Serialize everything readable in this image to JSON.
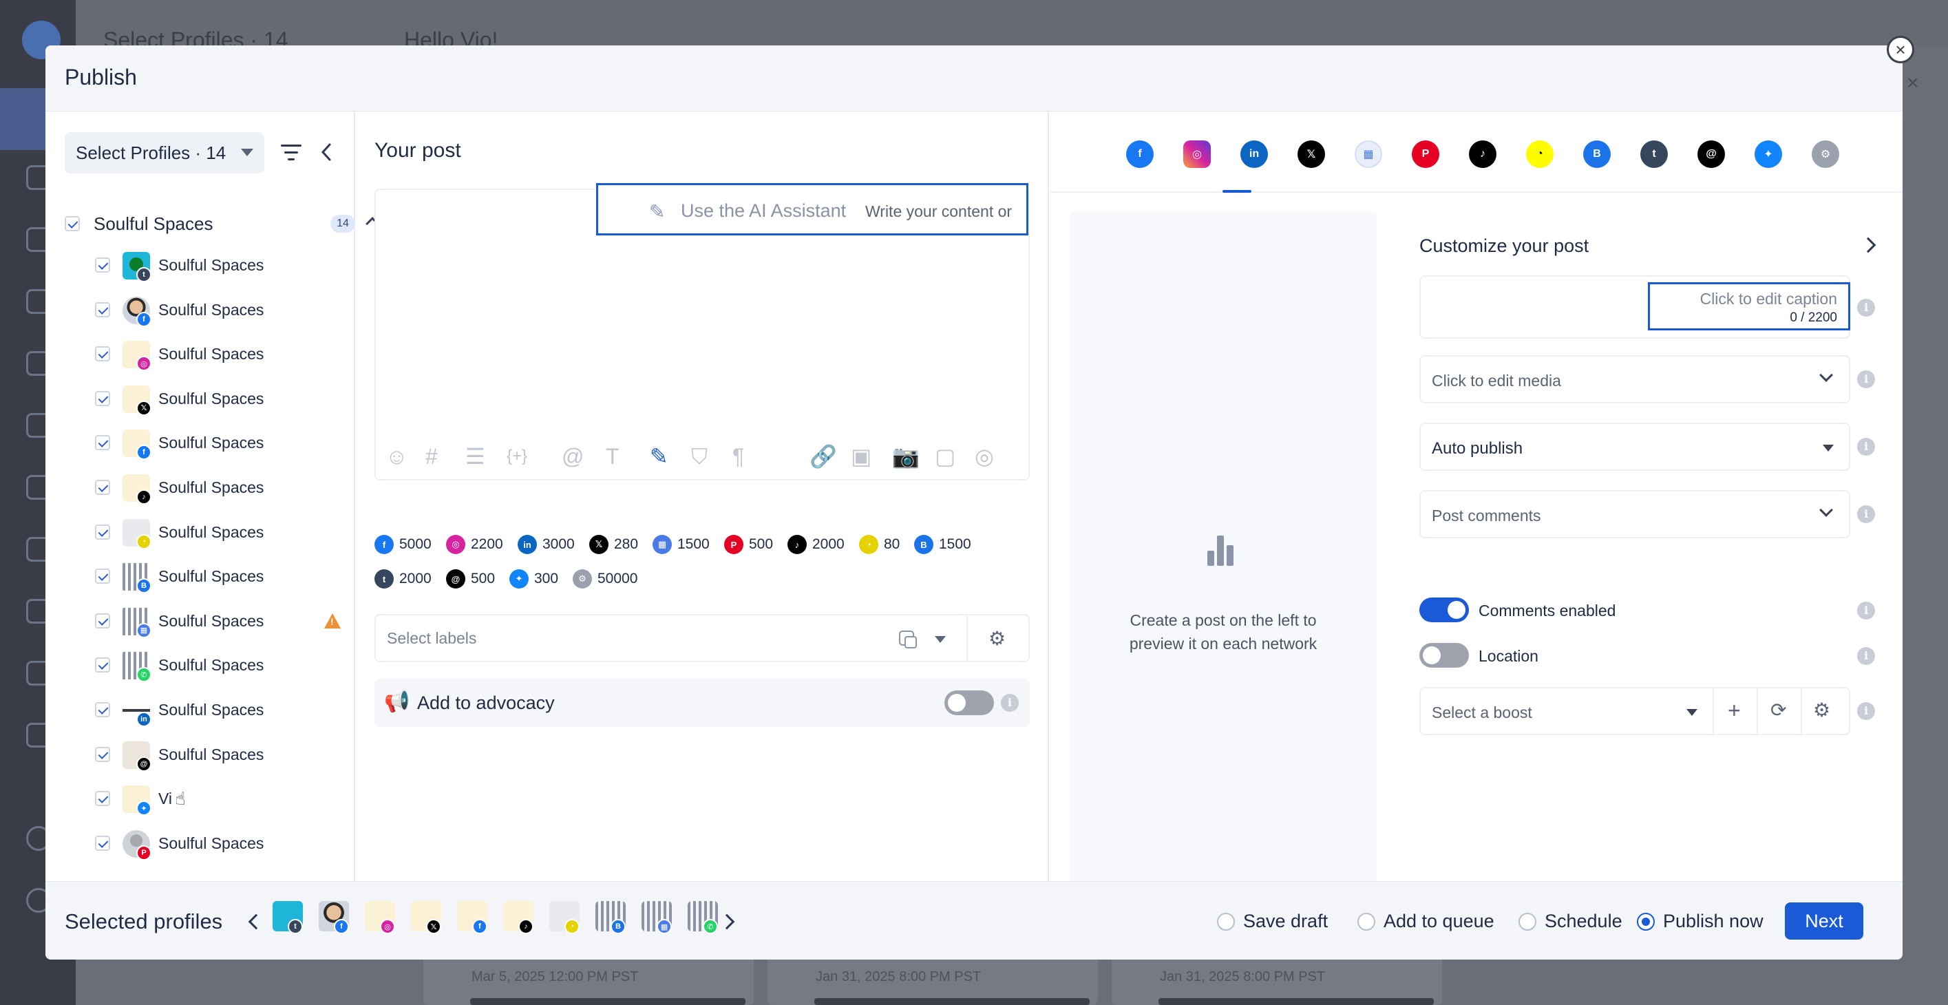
{
  "background": {
    "header_title": "Hello Vio!",
    "header_select": "Select Profiles · 14",
    "card_dates": [
      "Mar 5, 2025 12:00 PM PST",
      "Jan 31, 2025 8:00 PM PST",
      "Jan 31, 2025 8:00 PM PST"
    ]
  },
  "modal": {
    "title": "Publish",
    "close_label": "×"
  },
  "profiles": {
    "select_label": "Select Profiles · 14",
    "group_name": "Soulful Spaces",
    "group_count": "14",
    "items": [
      {
        "name": "Soulful Spaces",
        "avatar": "tumblr",
        "network": "tumblr",
        "net_glyph": "t",
        "net_color": "#36465d"
      },
      {
        "name": "Soulful Spaces",
        "avatar": "photo",
        "network": "facebook",
        "net_glyph": "f",
        "net_color": "#1877f2"
      },
      {
        "name": "Soulful Spaces",
        "avatar": "logo",
        "network": "instagram",
        "net_glyph": "◎",
        "net_color": "#d6249f"
      },
      {
        "name": "Soulful Spaces",
        "avatar": "logo",
        "network": "x",
        "net_glyph": "𝕏",
        "net_color": "#000000"
      },
      {
        "name": "Soulful Spaces",
        "avatar": "logo",
        "network": "facebook",
        "net_glyph": "f",
        "net_color": "#1877f2"
      },
      {
        "name": "Soulful Spaces",
        "avatar": "logo",
        "network": "tiktok",
        "net_glyph": "♪",
        "net_color": "#000000"
      },
      {
        "name": "Soulful Spaces",
        "avatar": "snap",
        "network": "snapchat",
        "net_glyph": "◔",
        "net_color": "#e6d200"
      },
      {
        "name": "Soulful Spaces",
        "avatar": "building",
        "network": "google-business",
        "net_glyph": "B",
        "net_color": "#1a73e8"
      },
      {
        "name": "Soulful Spaces",
        "avatar": "building",
        "network": "google-mybusiness",
        "net_glyph": "▦",
        "net_color": "#4a7ae8",
        "warning": true
      },
      {
        "name": "Soulful Spaces",
        "avatar": "building",
        "network": "whatsapp",
        "net_glyph": "✆",
        "net_color": "#25d366"
      },
      {
        "name": "Soulful Spaces",
        "avatar": "li",
        "network": "linkedin",
        "net_glyph": "in",
        "net_color": "#0a66c2"
      },
      {
        "name": "Soulful Spaces",
        "avatar": "threads",
        "network": "threads",
        "net_glyph": "@",
        "net_color": "#000000"
      },
      {
        "name": "Vi",
        "avatar": "logo",
        "network": "bluesky",
        "net_glyph": "✦",
        "net_color": "#1185fe",
        "cursor": true
      },
      {
        "name": "Soulful Spaces",
        "avatar": "grey",
        "network": "pinterest",
        "net_glyph": "P",
        "net_color": "#e60023"
      }
    ]
  },
  "post": {
    "heading": "Your post",
    "ai_label": "Use the AI Assistant",
    "ai_hint": "Write your content or",
    "toolbar_icons": [
      "emoji-icon",
      "hashtag-icon",
      "text-block-icon",
      "variable-icon",
      "mention-icon",
      "text-format-icon",
      "ai-wand-icon",
      "shield-icon",
      "paragraph-icon",
      "link-icon",
      "gif-icon",
      "camera-icon",
      "document-icon",
      "layers-icon"
    ],
    "char_limits": [
      {
        "network": "facebook",
        "glyph": "f",
        "color": "#1877f2",
        "limit": "5000"
      },
      {
        "network": "instagram",
        "glyph": "◎",
        "color": "#d6249f",
        "limit": "2200"
      },
      {
        "network": "linkedin",
        "glyph": "in",
        "color": "#0a66c2",
        "limit": "3000"
      },
      {
        "network": "x",
        "glyph": "𝕏",
        "color": "#000000",
        "limit": "280"
      },
      {
        "network": "google-mybusiness",
        "glyph": "▦",
        "color": "#4a7ae8",
        "limit": "1500"
      },
      {
        "network": "pinterest",
        "glyph": "P",
        "color": "#e60023",
        "limit": "500"
      },
      {
        "network": "tiktok",
        "glyph": "♪",
        "color": "#000000",
        "limit": "2000"
      },
      {
        "network": "snapchat",
        "glyph": "◔",
        "color": "#e6d200",
        "limit": "80"
      },
      {
        "network": "google-business",
        "glyph": "B",
        "color": "#1a73e8",
        "limit": "1500"
      },
      {
        "network": "tumblr",
        "glyph": "t",
        "color": "#36465d",
        "limit": "2000"
      },
      {
        "network": "threads",
        "glyph": "@",
        "color": "#000000",
        "limit": "500"
      },
      {
        "network": "bluesky",
        "glyph": "✦",
        "color": "#1185fe",
        "limit": "300"
      },
      {
        "network": "other",
        "glyph": "⚙",
        "color": "#9aa1ad",
        "limit": "50000"
      }
    ],
    "labels_placeholder": "Select labels",
    "advocacy_label": "Add to advocacy",
    "advocacy_enabled": false
  },
  "networks_tabs": [
    {
      "name": "facebook",
      "glyph": "f",
      "color": "#1877f2"
    },
    {
      "name": "instagram",
      "glyph": "◎",
      "color": "#d6249f",
      "active": true
    },
    {
      "name": "linkedin",
      "glyph": "in",
      "color": "#0a66c2"
    },
    {
      "name": "x",
      "glyph": "𝕏",
      "color": "#000000"
    },
    {
      "name": "google-mybusiness",
      "glyph": "▦",
      "color": "#4a7ae8"
    },
    {
      "name": "pinterest",
      "glyph": "P",
      "color": "#e60023"
    },
    {
      "name": "tiktok",
      "glyph": "♪",
      "color": "#000000"
    },
    {
      "name": "snapchat",
      "glyph": "◔",
      "color": "#fffc00"
    },
    {
      "name": "google-business",
      "glyph": "B",
      "color": "#1a73e8"
    },
    {
      "name": "tumblr",
      "glyph": "t",
      "color": "#36465d"
    },
    {
      "name": "threads",
      "glyph": "@",
      "color": "#000000"
    },
    {
      "name": "bluesky",
      "glyph": "✦",
      "color": "#1185fe"
    },
    {
      "name": "other",
      "glyph": "⚙",
      "color": "#9aa1ad"
    }
  ],
  "preview": {
    "line1": "Create a post on the left to",
    "line2": "preview it on each network"
  },
  "customize": {
    "title": "Customize your post",
    "caption_label": "Click to edit caption",
    "caption_count": "0 / 2200",
    "media_label": "Click to edit media",
    "publish_mode": "Auto publish",
    "comments_label": "Post comments",
    "comments_enabled_label": "Comments enabled",
    "comments_enabled": true,
    "location_label": "Location",
    "location_enabled": false,
    "boost_placeholder": "Select a boost"
  },
  "footer": {
    "title": "Selected profiles",
    "options": [
      {
        "label": "Save draft",
        "selected": false
      },
      {
        "label": "Add to queue",
        "selected": false
      },
      {
        "label": "Schedule",
        "selected": false
      },
      {
        "label": "Publish now",
        "selected": true
      }
    ],
    "next_label": "Next"
  }
}
